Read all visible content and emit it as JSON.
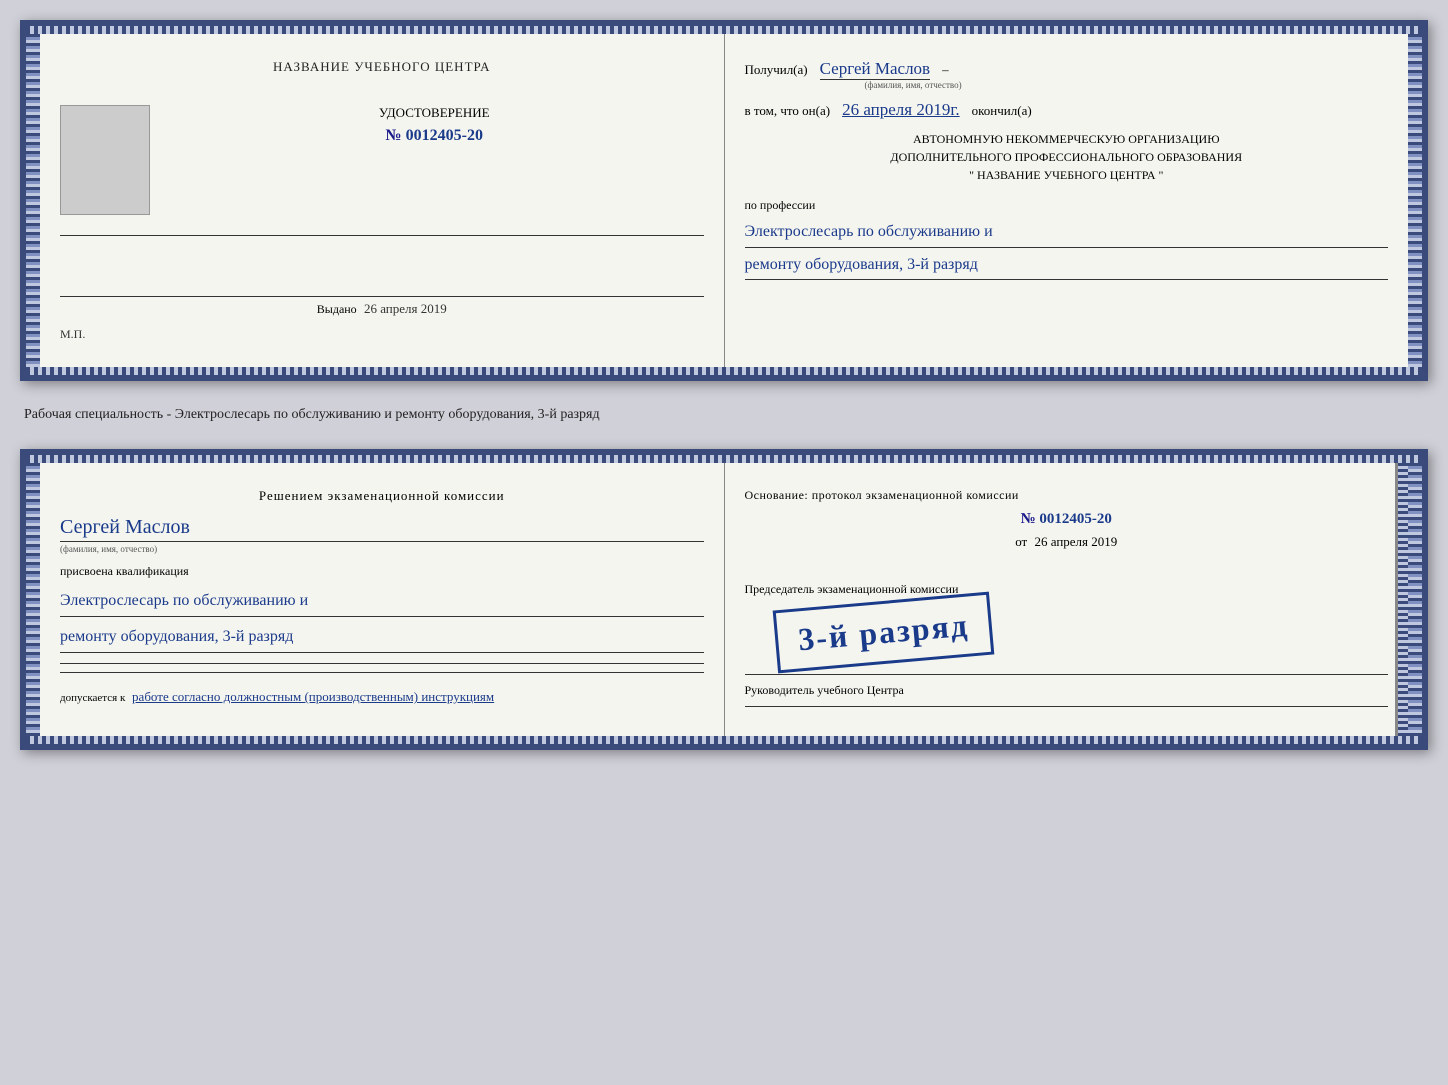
{
  "page": {
    "background": "#d0d0d8"
  },
  "first_booklet": {
    "left": {
      "center_title": "НАЗВАНИЕ УЧЕБНОГО ЦЕНТРА",
      "udost_label": "УДОСТОВЕРЕНИЕ",
      "number_prefix": "№",
      "number": "0012405-20",
      "issued_label": "Выдано",
      "issued_date": "26 апреля 2019",
      "mp_label": "М.П."
    },
    "right": {
      "received_label": "Получил(а)",
      "recipient_name": "Сергей Маслов",
      "name_field_label": "(фамилия, имя, отчество)",
      "dash": "–",
      "in_that_label": "в том, что он(а)",
      "completed_date": "26 апреля 2019г.",
      "finished_label": "окончил(а)",
      "org_line1": "АВТОНОМНУЮ НЕКОММЕРЧЕСКУЮ ОРГАНИЗАЦИЮ",
      "org_line2": "ДОПОЛНИТЕЛЬНОГО ПРОФЕССИОНАЛЬНОГО ОБРАЗОВАНИЯ",
      "org_line3": "\"   НАЗВАНИЕ УЧЕБНОГО ЦЕНТРА   \"",
      "by_profession_label": "по профессии",
      "profession_line1": "Электрослесарь по обслуживанию и",
      "profession_line2": "ремонту оборудования, 3-й разряд"
    }
  },
  "between_text": "Рабочая специальность - Электрослесарь по обслуживанию и ремонту оборудования, 3-й разряд",
  "second_booklet": {
    "left": {
      "decision_title": "Решением экзаменационной комиссии",
      "name": "Сергей Маслов",
      "name_field_label": "(фамилия, имя, отчество)",
      "assigned_label": "присвоена квалификация",
      "qualification_line1": "Электрослесарь по обслуживанию и",
      "qualification_line2": "ремонту оборудования, 3-й разряд",
      "admits_label": "допускается к",
      "admits_value": "работе согласно должностным (производственным) инструкциям"
    },
    "right": {
      "basis_label": "Основание: протокол экзаменационной комиссии",
      "number_prefix": "№",
      "number": "0012405-20",
      "from_label": "от",
      "from_date": "26 апреля 2019",
      "stamp_text": "3-й разряд",
      "chairman_label": "Председатель экзаменационной комиссии",
      "head_label": "Руководитель учебного Центра"
    }
  }
}
